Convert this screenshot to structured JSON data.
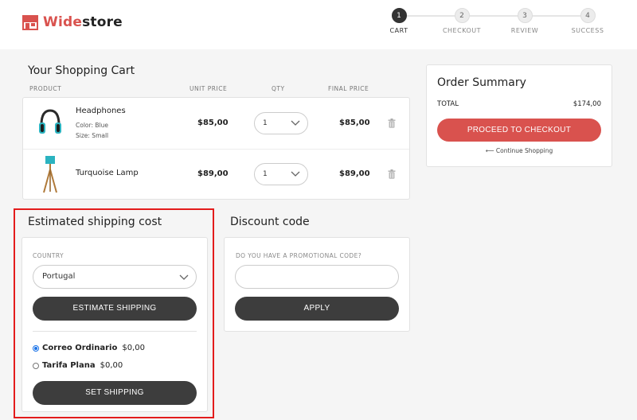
{
  "brand": {
    "name_part1": "Wide",
    "name_part2": "store",
    "accent_color": "#d9524e"
  },
  "steps": [
    {
      "number": "1",
      "label": "CART",
      "active": true
    },
    {
      "number": "2",
      "label": "CHECKOUT",
      "active": false
    },
    {
      "number": "3",
      "label": "REVIEW",
      "active": false
    },
    {
      "number": "4",
      "label": "SUCCESS",
      "active": false
    }
  ],
  "cart": {
    "title": "Your Shopping Cart",
    "columns": {
      "product": "PRODUCT",
      "unit_price": "UNIT PRICE",
      "qty": "QTY",
      "final_price": "FINAL PRICE"
    },
    "items": [
      {
        "name": "Headphones",
        "color": "Color: Blue",
        "size": "Size: Small",
        "unit_price": "$85,00",
        "qty": "1",
        "final_price": "$85,00",
        "icon": "headphones-image"
      },
      {
        "name": "Turquoise Lamp",
        "unit_price": "$89,00",
        "qty": "1",
        "final_price": "$89,00",
        "icon": "lamp-image"
      }
    ]
  },
  "summary": {
    "title": "Order Summary",
    "total_label": "TOTAL",
    "total_value": "$174,00",
    "checkout_label": "PROCEED TO CHECKOUT",
    "continue_label": "⟵ Continue Shopping"
  },
  "shipping": {
    "title": "Estimated shipping cost",
    "country_label": "COUNTRY",
    "country_value": "Portugal",
    "estimate_label": "ESTIMATE SHIPPING",
    "options": [
      {
        "name": "Correo Ordinario",
        "price": "$0,00",
        "checked": true
      },
      {
        "name": "Tarifa Plana",
        "price": "$0,00",
        "checked": false
      }
    ],
    "set_label": "SET SHIPPING"
  },
  "discount": {
    "title": "Discount code",
    "prompt": "DO YOU HAVE A PROMOTIONAL CODE?",
    "input_value": "",
    "apply_label": "APPLY"
  }
}
